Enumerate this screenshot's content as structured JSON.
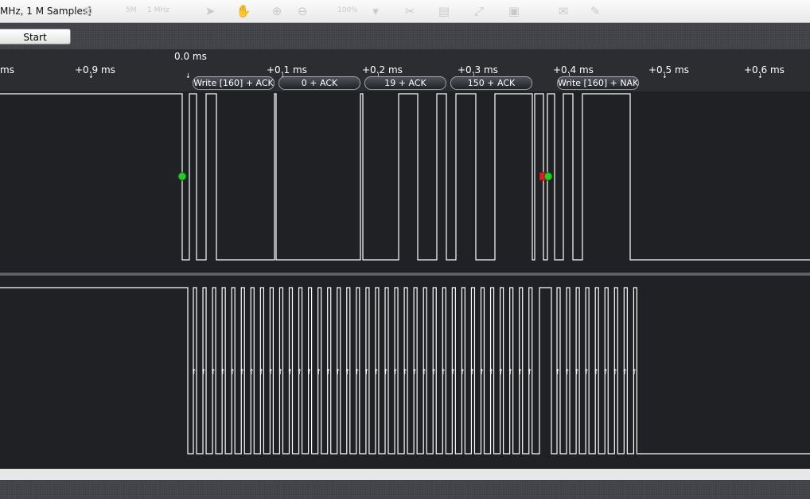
{
  "window": {
    "title": "MHz, 1 M Samples]"
  },
  "toolbar": {
    "zoom_text_1": "5M",
    "zoom_text_2": "1 MHz",
    "zoom_percent": "100%",
    "icons": [
      "cursor-icon",
      "hand-icon",
      "zoom-in-icon",
      "zoom-out-icon",
      "dropdown-icon",
      "cut-icon",
      "page-icon",
      "fit-icon",
      "image-icon",
      "chat-icon",
      "pen-icon"
    ]
  },
  "controls": {
    "start_label": "Start"
  },
  "timeline": {
    "trigger_label": "0.0 ms",
    "ticks": [
      "ms",
      "+0.9 ms",
      "+0.1 ms",
      "+0.2 ms",
      "+0.3 ms",
      "+0.4 ms",
      "+0.5 ms",
      "+0.6 ms"
    ]
  },
  "decoder": {
    "frames": [
      "Write [160] + ACK",
      "0 + ACK",
      "19 + ACK",
      "150 + ACK",
      "Write [160] + NAK"
    ]
  },
  "markers": {
    "start_marker_color": "#22cc22",
    "stop_marker_color": "#e02020"
  },
  "colors": {
    "waveform": "#ffffff",
    "channel_bg": "#1f2125",
    "chrome_bg": "#3f4147"
  }
}
